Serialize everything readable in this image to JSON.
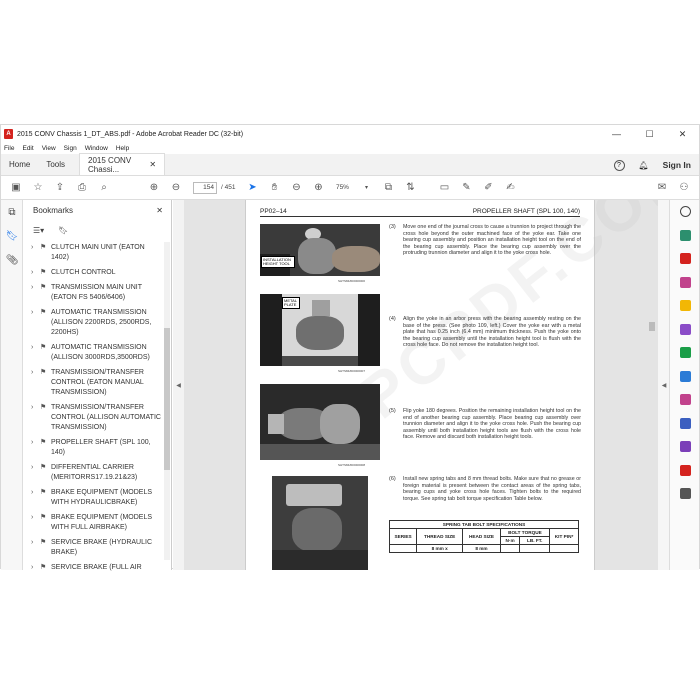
{
  "window": {
    "title": "2015 CONV Chassis 1_DT_ABS.pdf - Adobe Acrobat Reader DC (32-bit)",
    "logo": "A",
    "minimize": "—",
    "maximize": "☐",
    "close": "✕"
  },
  "menu": [
    "File",
    "Edit",
    "View",
    "Sign",
    "Window",
    "Help"
  ],
  "tabs": {
    "home": "Home",
    "tools": "Tools",
    "doc": "2015 CONV Chassi...",
    "doc_close": "✕",
    "help": "?",
    "signin": "Sign In"
  },
  "toolbar": {
    "page_current": "154",
    "page_total": "/ 451",
    "zoom": "75%"
  },
  "bookmarks": {
    "title": "Bookmarks",
    "close": "✕",
    "items": [
      {
        "label": "CLUTCH MAIN UNIT (EATON 1402)"
      },
      {
        "label": "CLUTCH CONTROL"
      },
      {
        "label": "TRANSMISSION MAIN UNIT (EATON FS 5406/6406)"
      },
      {
        "label": "AUTOMATIC TRANSMISSION (ALLISON 2200RDS, 2500RDS, 2200HS)"
      },
      {
        "label": "AUTOMATIC TRANSMISSION (ALLISON 3000RDS,3500RDS)"
      },
      {
        "label": "TRANSMISSION/TRANSFER CONTROL (EATON MANUAL TRANSMISSION)"
      },
      {
        "label": "TRANSMISSION/TRANSFER CONTROL (ALLISON AUTOMATIC TRANSMISSION)"
      },
      {
        "label": "PROPELLER SHAFT (SPL 100, 140)"
      },
      {
        "label": "DIFFERENTIAL CARRIER (MERITORRS17.19.21&23)"
      },
      {
        "label": "BRAKE EQUIPMENT (MODELS WITH HYDRAULICBRAKE)"
      },
      {
        "label": "BRAKE EQUIPMENT (MODELS WITH FULL AIRBRAKE)"
      },
      {
        "label": "SERVICE BRAKE (HYDRAULIC BRAKE)"
      },
      {
        "label": "SERVICE BRAKE (FULL AIR"
      }
    ]
  },
  "page": {
    "header_left": "PP02–14",
    "header_right": "PROPELLER SHAFT (SPL 100, 140)",
    "steps": [
      {
        "num": "(3)",
        "text": "Move one end of the journal cross to cause a trunnion to project through the cross hole beyond the outer machined face of the yoke ear. Take one bearing cup assembly and position an installation height tool on the end of the bearing cup assembly. Place the bearing cup assembly over the protruding trunnion diameter and align it to the yoke cross hole.",
        "caption": "SHTS84ZD0000000",
        "label": "INSTALLATION HEIGHT TOOL"
      },
      {
        "num": "(4)",
        "text": "Align the yoke in an arbor press with the bearing assembly resting on the base of the press. (See photo 109, left.) Cover the yoke ear with a metal plate that has 0.25 inch (6.4 mm) minimum thickness. Push the yoke onto the bearing cup assembly until the installation height tool is flush with the cross hole face. Do not remove the installation height tool.",
        "caption": "SHTS84ZD0000007",
        "label": "METAL PLATE"
      },
      {
        "num": "(5)",
        "text": "Flip yoke 180 degrees. Position the remaining installation height tool on the end of another bearing cup assembly. Place bearing cup assembly over trunnion diameter and align it to the yoke cross hole. Push the bearing cup assembly until both installation height tools are flush with the cross hole face. Remove and discard both installation height tools.",
        "caption": "SHTS84ZD0000008"
      },
      {
        "num": "(6)",
        "text": "Install new spring tabs and 8 mm thread bolts. Make sure that no grease or foreign material is present between the contact areas of the spring tabs, bearing cups and yoke cross hole faces. Tighten bolts to the required torque. See spring tab bolt torque specification Table below."
      }
    ],
    "table": {
      "title": "SPRING TAB BOLT SPECIFICATIONS",
      "h_series": "SERIES",
      "h_thread": "THREAD SIZE",
      "h_head": "HEAD SIZE",
      "h_torque": "BOLT TORQUE",
      "h_nm": "N·m",
      "h_lbft": "LB. FT.",
      "h_kit": "KIT PIN*",
      "r1_thread": "8 mm x",
      "r1_head": "8 mm"
    }
  },
  "colors": {
    "accent": "#1a73e8",
    "adobe_red": "#d4231e"
  }
}
